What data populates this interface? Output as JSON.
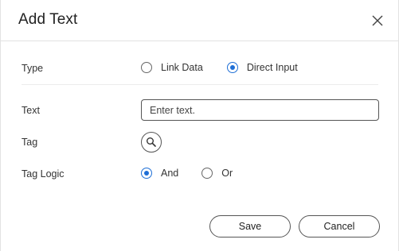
{
  "dialog": {
    "title": "Add Text",
    "close_icon": "close-icon"
  },
  "type_row": {
    "label": "Type",
    "options": [
      {
        "label": "Link Data",
        "selected": false
      },
      {
        "label": "Direct Input",
        "selected": true
      }
    ]
  },
  "text_row": {
    "label": "Text",
    "value": "",
    "placeholder": "Enter text."
  },
  "tag_row": {
    "label": "Tag",
    "icon": "search-icon"
  },
  "tag_logic_row": {
    "label": "Tag Logic",
    "options": [
      {
        "label": "And",
        "selected": true
      },
      {
        "label": "Or",
        "selected": false
      }
    ]
  },
  "footer": {
    "save_label": "Save",
    "cancel_label": "Cancel"
  },
  "colors": {
    "accent": "#1f6fd6",
    "border": "#555555",
    "divider": "#e1e1e1"
  }
}
